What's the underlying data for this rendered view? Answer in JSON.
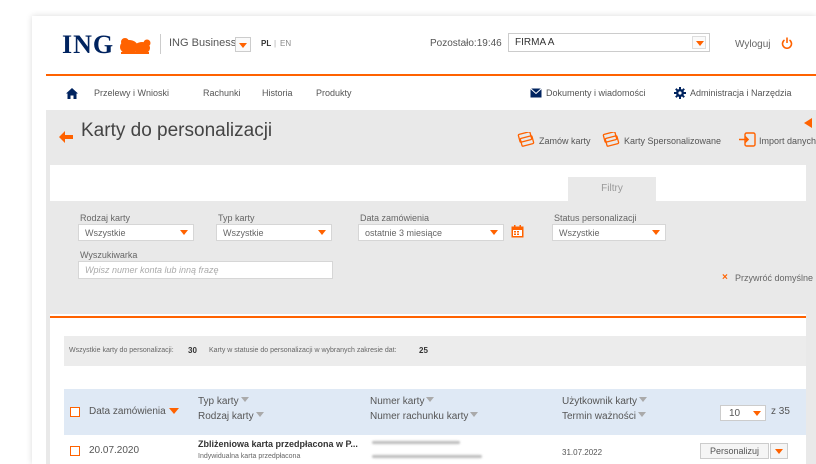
{
  "header": {
    "logo": "ING",
    "product": "ING Business",
    "lang_active": "PL",
    "lang_sep": "|",
    "lang_other": "EN",
    "session_timer": "Pozostało:19:46",
    "company": "FIRMA A",
    "logout": "Wyloguj",
    "accent": "#ff6200",
    "brand": "#00235f"
  },
  "nav": {
    "items": [
      "Przelewy i Wnioski",
      "Rachunki",
      "Historia",
      "Produkty"
    ],
    "documents": "Dokumenty i wiadomości",
    "admin": "Administracja i Narzędzia"
  },
  "page": {
    "title": "Karty do personalizacji",
    "actions": [
      "Zamów karty",
      "Karty Spersonalizowane",
      "Import danych"
    ]
  },
  "filters": {
    "tab": "Filtry",
    "card_kind_label": "Rodzaj karty",
    "card_kind_value": "Wszystkie",
    "card_type_label": "Typ karty",
    "card_type_value": "Wszystkie",
    "order_date_label": "Data zamówienia",
    "order_date_value": "ostatnie 3 miesiące",
    "status_label": "Status personalizacji",
    "status_value": "Wszystkie",
    "search_label": "Wyszukiwarka",
    "search_placeholder": "Wpisz numer konta lub inną frazę",
    "restore": "Przywróć domyślne"
  },
  "summary": {
    "all_label": "Wszystkie karty do personalizacji:",
    "all_count": "30",
    "status_label": "Karty w statusie do personalizacji w wybranych zakresie dat:",
    "status_count": "25"
  },
  "table": {
    "col_order_date": "Data zamówienia",
    "col_card_type": "Typ karty",
    "col_card_kind": "Rodzaj karty",
    "col_card_number": "Numer karty",
    "col_account_number": "Numer rachunku karty",
    "col_user": "Użytkownik karty",
    "col_expiry": "Termin ważności",
    "page_size": "10",
    "page_total": "z 35",
    "rows": [
      {
        "date": "20.07.2020",
        "type": "Zbliżeniowa karta przedpłacona w P...",
        "kind": "Indywidualna karta przedpłacona",
        "expiry": "31.07.2022",
        "action": "Personalizuj"
      }
    ]
  }
}
